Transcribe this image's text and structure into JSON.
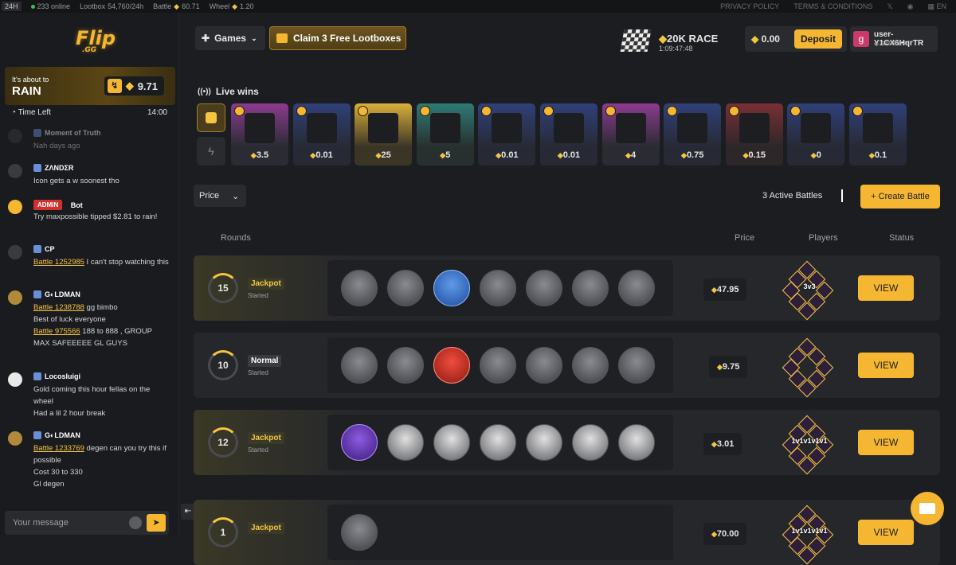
{
  "topbar": {
    "range": "24H",
    "online": "233 online",
    "lootbox_label": "Lootbox",
    "lootbox_value": "54,760/24h",
    "battle_label": "Battle",
    "battle_value": "60.71",
    "wheel_label": "Wheel",
    "wheel_value": "1.20",
    "privacy": "PRIVACY POLICY",
    "terms": "TERMS & CONDITIONS",
    "lang": "EN"
  },
  "sidebar": {
    "logo_text": "Flip",
    "logo_sub": ".GG",
    "rain": {
      "line1": "It's about to",
      "line2": "RAIN",
      "amount": "9.71"
    },
    "time_left_label": "Time Left",
    "time_left_value": "14:00",
    "messages": [
      {
        "name": "Moment of Truth",
        "text": "Nah days ago"
      },
      {
        "name": "ZΛNDΣR",
        "text": "Icon gets a w soonest tho"
      },
      {
        "badge": "ADMIN",
        "name": "Bot",
        "text": "Try maxpossible tipped $2.81 to rain!"
      },
      {
        "name": "CP",
        "link": "Battle 1252985",
        "text": " I can't stop watching this"
      },
      {
        "name": "G◐LDMAN",
        "link": "Battle 1238788",
        "text": " gg bimbo",
        "text2": "Best of luck everyone",
        "link2": "Battle 975566",
        "text3": " 188 to 888 , GROUP MAX SAFEEEEE GL GUYS"
      },
      {
        "name": "Locosluigi",
        "text": "Gold coming this hour fellas on the wheel",
        "text2": "Had a lil 2 hour break"
      },
      {
        "name": "G◐LDMAN",
        "link": "Battle 1233769",
        "text": " degen can you try this if possible",
        "text2": "Cost 30 to 330",
        "text3": "Gl degen"
      }
    ],
    "input_placeholder": "Your message"
  },
  "header": {
    "games_label": "Games",
    "claim_label": "Claim 3 Free Lootboxes",
    "race_title": "20K RACE",
    "race_time": "1:09:47:48",
    "balance": "0.00",
    "deposit_label": "Deposit",
    "user_initial": "g",
    "username": "user-Y1CX6HqrTR",
    "rank": "GAMBLER"
  },
  "live": {
    "title": "Live wins",
    "wins": [
      {
        "value": "3.5",
        "style": "pink"
      },
      {
        "value": "0.01",
        "style": "blue"
      },
      {
        "value": "25",
        "style": "gold"
      },
      {
        "value": "5",
        "style": "teal"
      },
      {
        "value": "0.01",
        "style": "blue"
      },
      {
        "value": "0.01",
        "style": "blue"
      },
      {
        "value": "4",
        "style": "pink"
      },
      {
        "value": "0.75",
        "style": "blue"
      },
      {
        "value": "0.15",
        "style": "red"
      },
      {
        "value": "0",
        "style": "blue"
      },
      {
        "value": "0.1",
        "style": "blue"
      }
    ]
  },
  "battles_toolbar": {
    "sort_label": "Price",
    "active_count": "3 Active Battles",
    "create_label": "+ Create Battle"
  },
  "columns": {
    "rounds": "Rounds",
    "price": "Price",
    "players": "Players",
    "status": "Status"
  },
  "battles": [
    {
      "rounds": "15",
      "mode": "Jackpot",
      "status": "Started",
      "price": "47.95",
      "players_label": "3v3",
      "view": "VIEW"
    },
    {
      "rounds": "10",
      "mode": "Normal",
      "status": "Started",
      "price": "9.75",
      "players_label": "",
      "view": "VIEW"
    },
    {
      "rounds": "12",
      "mode": "Jackpot",
      "status": "Started",
      "price": "3.01",
      "players_label": "1v1v1v1v1",
      "view": "VIEW"
    },
    {
      "rounds": "1",
      "mode": "Jackpot",
      "status": "",
      "price": "70.00",
      "players_label": "1v1v1v1v1",
      "view": "VIEW"
    }
  ]
}
